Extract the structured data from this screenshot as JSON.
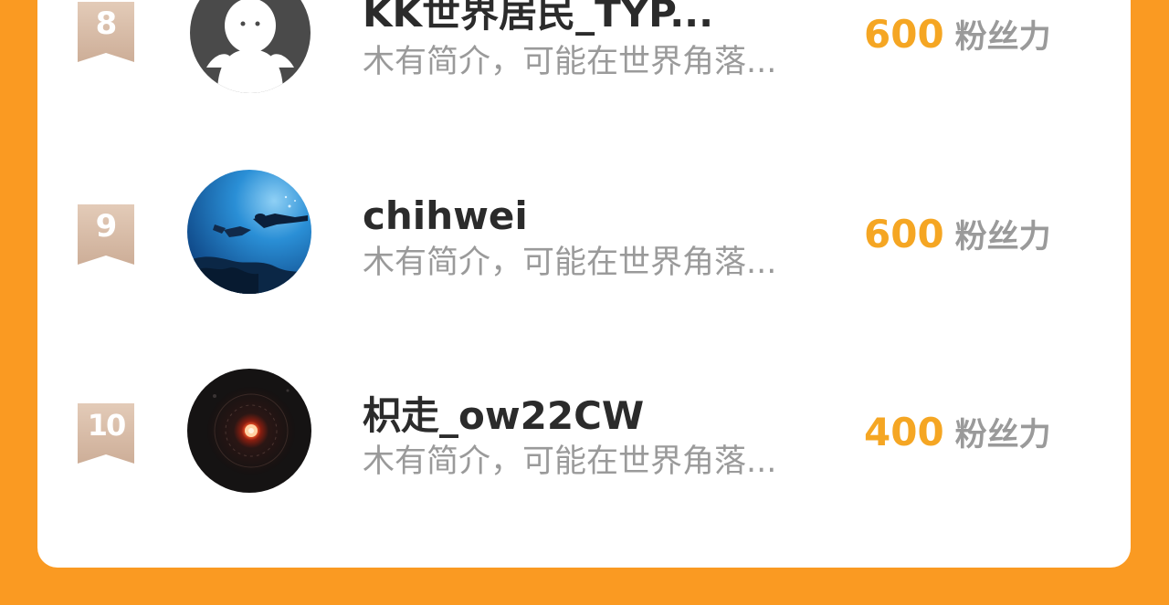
{
  "ranking": {
    "rows": [
      {
        "rank": "8",
        "name": "KK世界居民_TYP...",
        "bio": "木有简介，可能在世界角落...",
        "fans_value": "600",
        "fans_label": "粉丝力",
        "avatar": "default-avatar-icon"
      },
      {
        "rank": "9",
        "name": "chihwei",
        "bio": "木有简介，可能在世界角落...",
        "fans_value": "600",
        "fans_label": "粉丝力",
        "avatar": "diver-photo"
      },
      {
        "rank": "10",
        "name": "枳走_ow22CW",
        "bio": "木有简介，可能在世界角落...",
        "fans_value": "400",
        "fans_label": "粉丝力",
        "avatar": "dark-orb-photo"
      }
    ]
  },
  "colors": {
    "background": "#FA9A22",
    "card": "#ffffff",
    "fans_value": "#F5A623",
    "secondary_text": "#9a9a9a",
    "badge": "#D5B8A2"
  }
}
